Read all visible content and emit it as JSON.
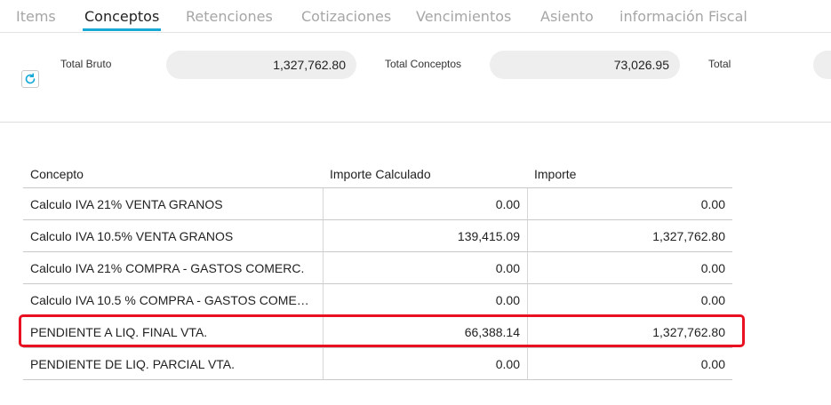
{
  "tabs": [
    {
      "label": "Items",
      "active": false
    },
    {
      "label": "Conceptos",
      "active": true
    },
    {
      "label": "Retenciones",
      "active": false
    },
    {
      "label": "Cotizaciones",
      "active": false
    },
    {
      "label": "Vencimientos",
      "active": false
    },
    {
      "label": "Asiento",
      "active": false
    },
    {
      "label": "información Fiscal",
      "active": false
    }
  ],
  "totals": {
    "refresh_icon": "refresh-icon",
    "total_bruto_label": "Total Bruto",
    "total_bruto_value": "1,327,762.80",
    "total_conceptos_label": "Total Conceptos",
    "total_conceptos_value": "73,026.95",
    "total_label": "Total",
    "total_value": ""
  },
  "table": {
    "columns": [
      "Concepto",
      "Importe Calculado",
      "Importe"
    ],
    "rows": [
      {
        "concepto": "Calculo IVA 21% VENTA GRANOS",
        "importe_calculado": "0.00",
        "importe": "0.00"
      },
      {
        "concepto": "Calculo IVA 10.5% VENTA GRANOS",
        "importe_calculado": "139,415.09",
        "importe": "1,327,762.80"
      },
      {
        "concepto": "Calculo IVA 21% COMPRA - GASTOS COMERC.",
        "importe_calculado": "0.00",
        "importe": "0.00"
      },
      {
        "concepto": "Calculo IVA 10.5 % COMPRA - GASTOS COME…",
        "importe_calculado": "0.00",
        "importe": "0.00"
      },
      {
        "concepto": "PENDIENTE A LIQ. FINAL VTA.",
        "importe_calculado": "66,388.14",
        "importe": "1,327,762.80"
      },
      {
        "concepto": "PENDIENTE DE LIQ. PARCIAL VTA.",
        "importe_calculado": "0.00",
        "importe": "0.00"
      }
    ]
  },
  "colors": {
    "accent": "#17a9d6",
    "highlight_border": "#e81021",
    "tab_inactive": "#a6a6a6"
  }
}
